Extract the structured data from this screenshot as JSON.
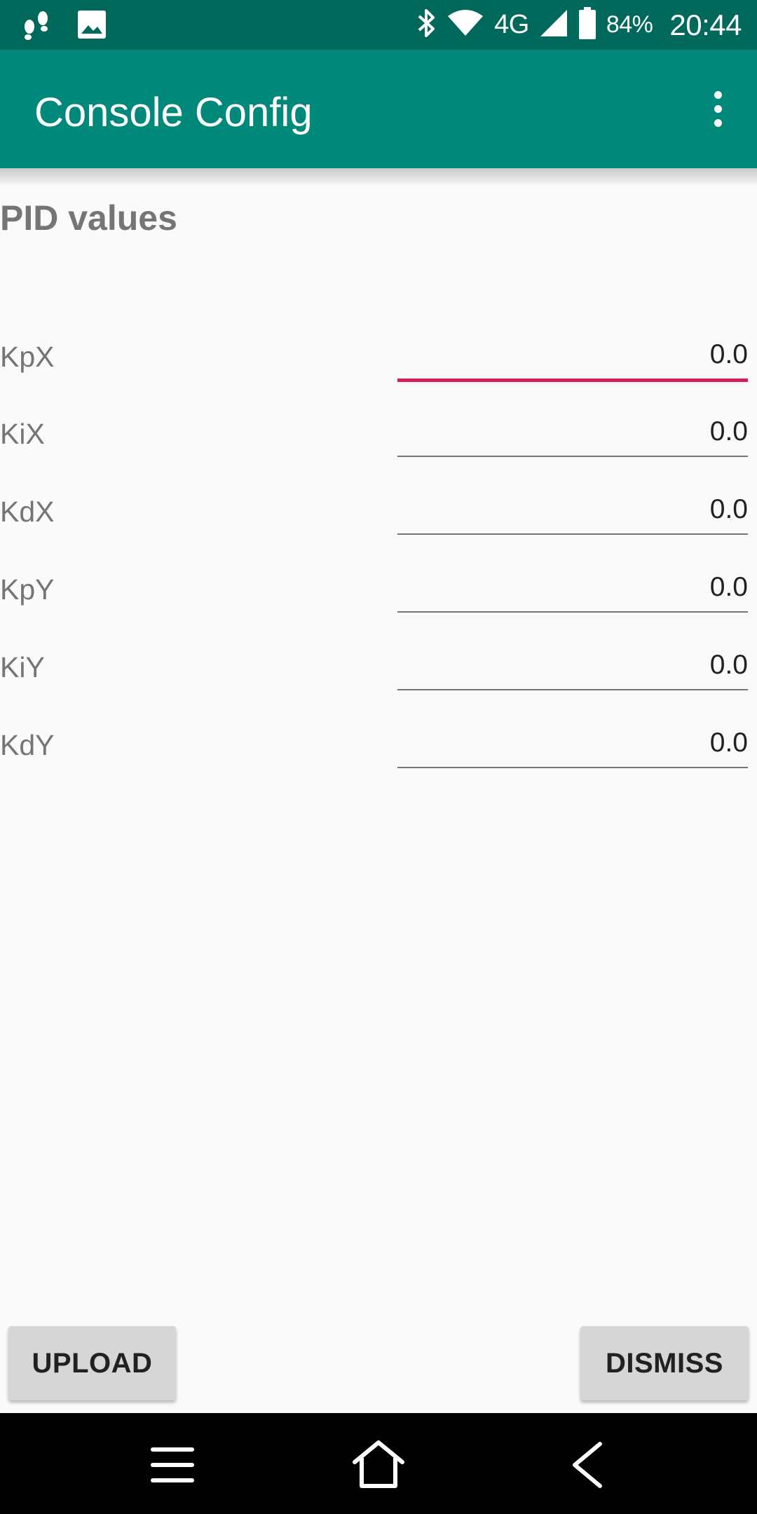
{
  "status_bar": {
    "network": "4G",
    "battery_percent": "84%",
    "time": "20:44",
    "icons": [
      "footsteps-icon",
      "image-icon",
      "bluetooth-icon",
      "wifi-icon",
      "signal-icon",
      "battery-icon"
    ]
  },
  "app_bar": {
    "title": "Console Config",
    "menu_icon": "more-vert-icon"
  },
  "section": {
    "title": "PID values"
  },
  "fields": [
    {
      "label": "KpX",
      "value": "0.0",
      "focused": true
    },
    {
      "label": "KiX",
      "value": "0.0",
      "focused": false
    },
    {
      "label": "KdX",
      "value": "0.0",
      "focused": false
    },
    {
      "label": "KpY",
      "value": "0.0",
      "focused": false
    },
    {
      "label": "KiY",
      "value": "0.0",
      "focused": false
    },
    {
      "label": "KdY",
      "value": "0.0",
      "focused": false
    }
  ],
  "buttons": {
    "upload": "UPLOAD",
    "dismiss": "DISMISS"
  },
  "nav_bar": {
    "icons": [
      "menu-icon",
      "home-icon",
      "back-icon"
    ]
  },
  "colors": {
    "status_bar": "#00695c",
    "app_bar": "#00897b",
    "accent": "#d81b60"
  }
}
